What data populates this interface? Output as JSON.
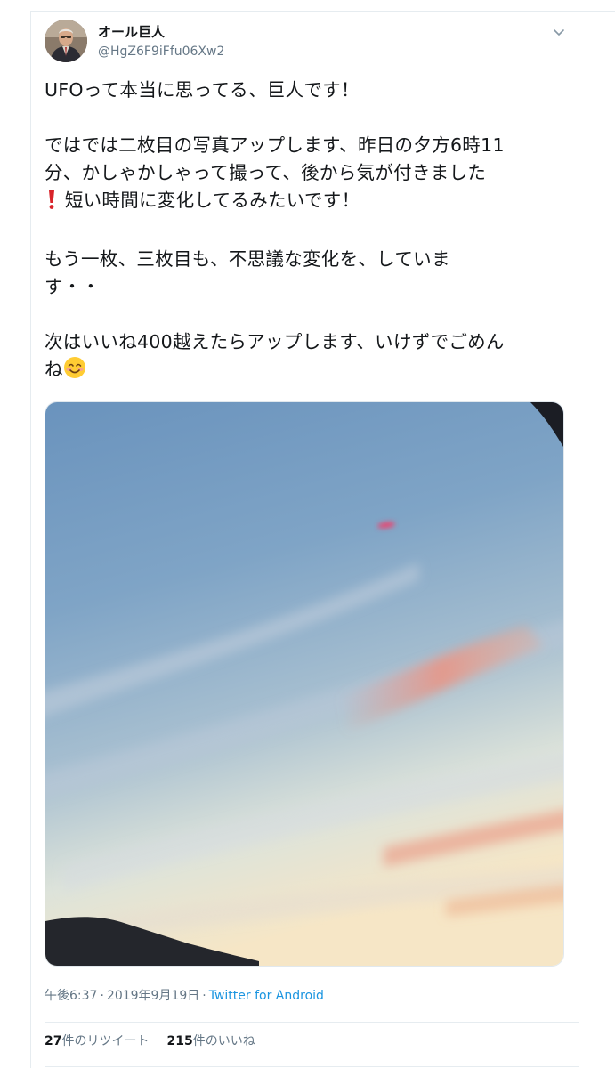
{
  "author": {
    "name": "オール巨人",
    "handle": "@HgZ6F9iFfu06Xw2"
  },
  "tweet": {
    "line1": "UFOって本当に思ってる、巨人です！",
    "line2": "ではでは二枚目の写真アップします、昨日の夕方6時11",
    "line3": "分、かしゃかしゃって撮って、後から気が付きました",
    "line4": "短い時間に変化してるみたいです！",
    "line5": "もう一枚、三枚目も、不思議な変化を、していま",
    "line6": "す・・",
    "line7": "次はいいね400越えたらアップします、いけずでごめん",
    "line8": "ね"
  },
  "icons": {
    "exclamation": "red-exclamation-icon",
    "smile": "smiling-face-icon",
    "menu": "chevron-down-icon"
  },
  "meta": {
    "time": "午後6:37",
    "separator": "·",
    "date": "2019年9月19日",
    "source": "Twitter for Android"
  },
  "stats": {
    "retweets_count": "27",
    "retweets_label": "件のリツイート",
    "likes_count": "215",
    "likes_label": "件のいいね"
  },
  "colors": {
    "link": "#1b95e0",
    "secondary_text": "#657786",
    "primary_text": "#14171a"
  }
}
